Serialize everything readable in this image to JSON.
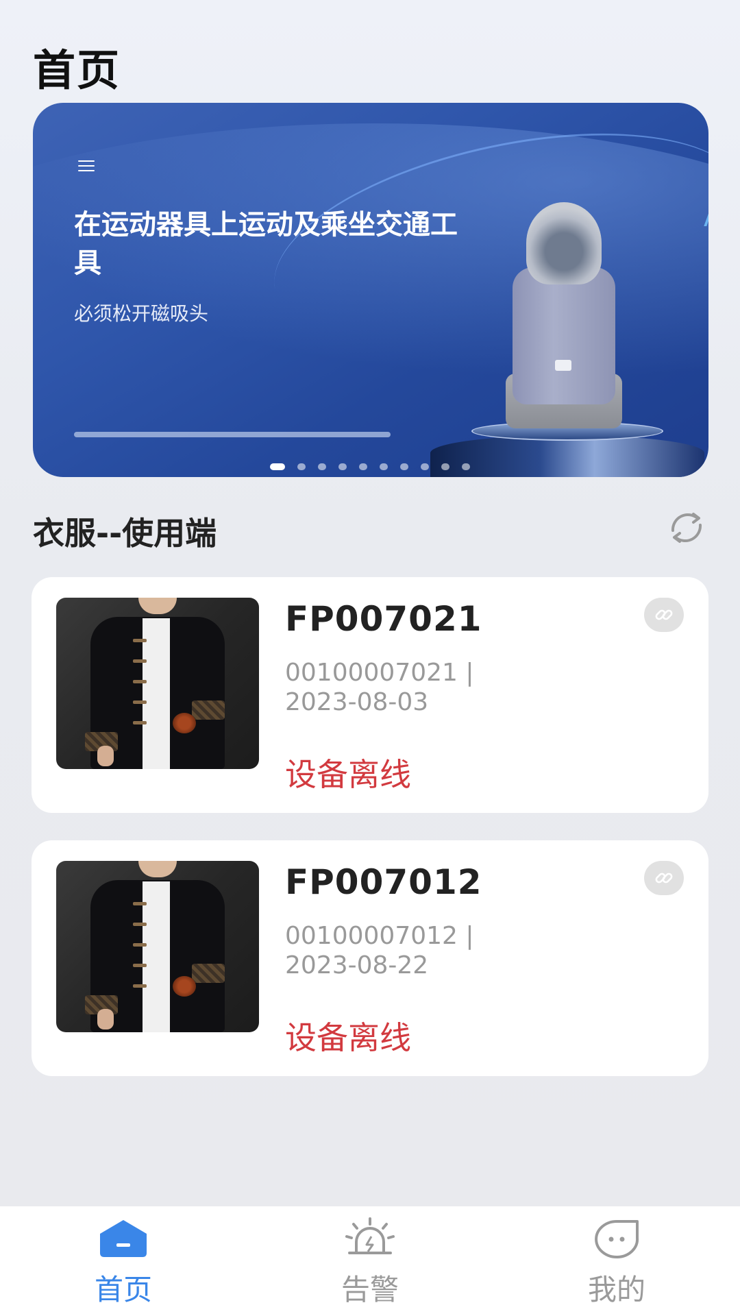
{
  "header": {
    "title": "首页"
  },
  "banner": {
    "menu_icon": "menu-icon",
    "headline": "在运动器具上运动及乘坐交通工具",
    "subline": "必须松开磁吸头",
    "slide_count": 10,
    "active_slide": 1
  },
  "section": {
    "title": "衣服--使用端",
    "refresh_icon": "refresh-icon"
  },
  "devices": [
    {
      "code": "FP007021",
      "meta": "00100007021 | 2023-08-03",
      "status": "设备离线",
      "link_icon": "link-icon"
    },
    {
      "code": "FP007012",
      "meta": "00100007012 | 2023-08-22",
      "status": "设备离线",
      "link_icon": "link-icon"
    }
  ],
  "nav": {
    "items": [
      {
        "label": "首页",
        "icon": "home-icon",
        "active": true
      },
      {
        "label": "告警",
        "icon": "alarm-icon",
        "active": false
      },
      {
        "label": "我的",
        "icon": "profile-icon",
        "active": false
      }
    ]
  },
  "colors": {
    "accent": "#3a86e8",
    "status_offline": "#d23a3f",
    "banner_blue": "#2f56ab"
  }
}
